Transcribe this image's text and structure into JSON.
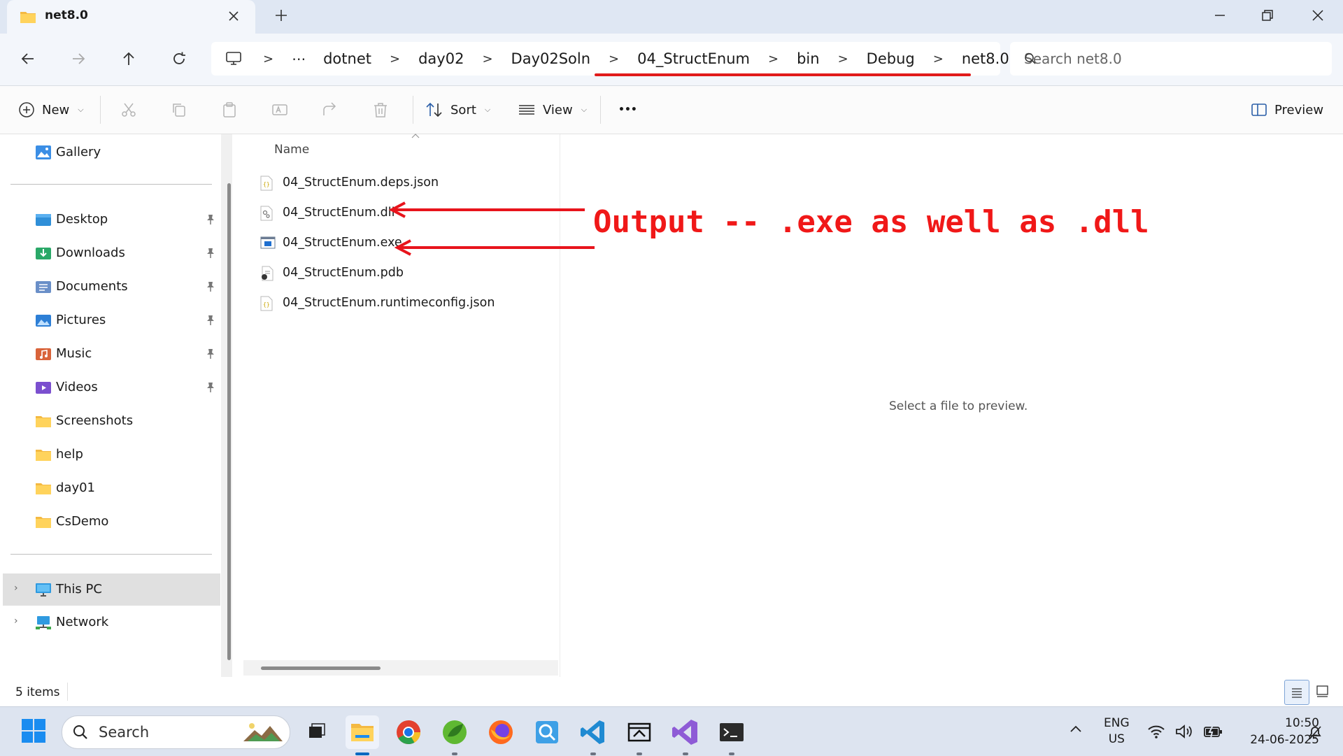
{
  "window": {
    "tab_title": "net8.0"
  },
  "address": {
    "overflow": "⋯",
    "crumbs": [
      "dotnet",
      "day02",
      "Day02Soln",
      "04_StructEnum",
      "bin",
      "Debug",
      "net8.0"
    ],
    "search_placeholder": "Search net8.0"
  },
  "toolbar": {
    "new_label": "New",
    "sort_label": "Sort",
    "view_label": "View",
    "more_label": "•••",
    "preview_label": "Preview"
  },
  "sidebar": {
    "gallery": "Gallery",
    "quick": [
      {
        "label": "Desktop",
        "icon": "desktop-icon",
        "pinned": true
      },
      {
        "label": "Downloads",
        "icon": "downloads-icon",
        "pinned": true
      },
      {
        "label": "Documents",
        "icon": "documents-icon",
        "pinned": true
      },
      {
        "label": "Pictures",
        "icon": "pictures-icon",
        "pinned": true
      },
      {
        "label": "Music",
        "icon": "music-icon",
        "pinned": true
      },
      {
        "label": "Videos",
        "icon": "videos-icon",
        "pinned": true
      },
      {
        "label": "Screenshots",
        "icon": "folder-icon",
        "pinned": false
      },
      {
        "label": "help",
        "icon": "folder-icon",
        "pinned": false
      },
      {
        "label": "day01",
        "icon": "folder-icon",
        "pinned": false
      },
      {
        "label": "CsDemo",
        "icon": "folder-icon",
        "pinned": false
      }
    ],
    "this_pc": "This PC",
    "network": "Network"
  },
  "files": {
    "column_name": "Name",
    "items": [
      {
        "name": "04_StructEnum.deps.json",
        "icon": "json-file-icon"
      },
      {
        "name": "04_StructEnum.dll",
        "icon": "dll-file-icon"
      },
      {
        "name": "04_StructEnum.exe",
        "icon": "exe-file-icon"
      },
      {
        "name": "04_StructEnum.pdb",
        "icon": "pdb-file-icon"
      },
      {
        "name": "04_StructEnum.runtimeconfig.json",
        "icon": "json-file-icon"
      }
    ]
  },
  "preview": {
    "empty_text": "Select a file to preview."
  },
  "annotation": {
    "text": "Output -- .exe as well as .dll",
    "color": "#f01818"
  },
  "status": {
    "item_count": "5 items"
  },
  "taskbar": {
    "search_label": "Search",
    "lang_line1": "ENG",
    "lang_line2": "US",
    "time": "10:50",
    "date": "24-06-2025"
  }
}
